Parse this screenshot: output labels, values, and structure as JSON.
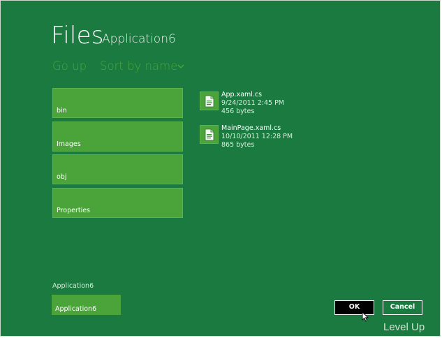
{
  "header": {
    "title": "Files",
    "subtitle": "Application6"
  },
  "commands": {
    "go_up": "Go up",
    "sort": "Sort by name"
  },
  "folders": [
    {
      "label": "bin"
    },
    {
      "label": "Images"
    },
    {
      "label": "obj"
    },
    {
      "label": "Properties"
    }
  ],
  "files": [
    {
      "name": "App.xaml.cs",
      "date": "9/24/2011 2:45 PM",
      "size": "456 bytes"
    },
    {
      "name": "MainPage.xaml.cs",
      "date": "10/10/2011 12:28 PM",
      "size": "865 bytes"
    }
  ],
  "basket": {
    "heading": "Application6",
    "item": "Application6"
  },
  "buttons": {
    "ok": "OK",
    "cancel": "Cancel"
  },
  "watermark": "Level Up",
  "colors": {
    "background": "#1b7a40",
    "accent": "#4aa43a"
  },
  "icons": {
    "sort_dropdown": "chevron-down-icon",
    "file": "code-file-icon",
    "cursor": "mouse-pointer-icon"
  }
}
